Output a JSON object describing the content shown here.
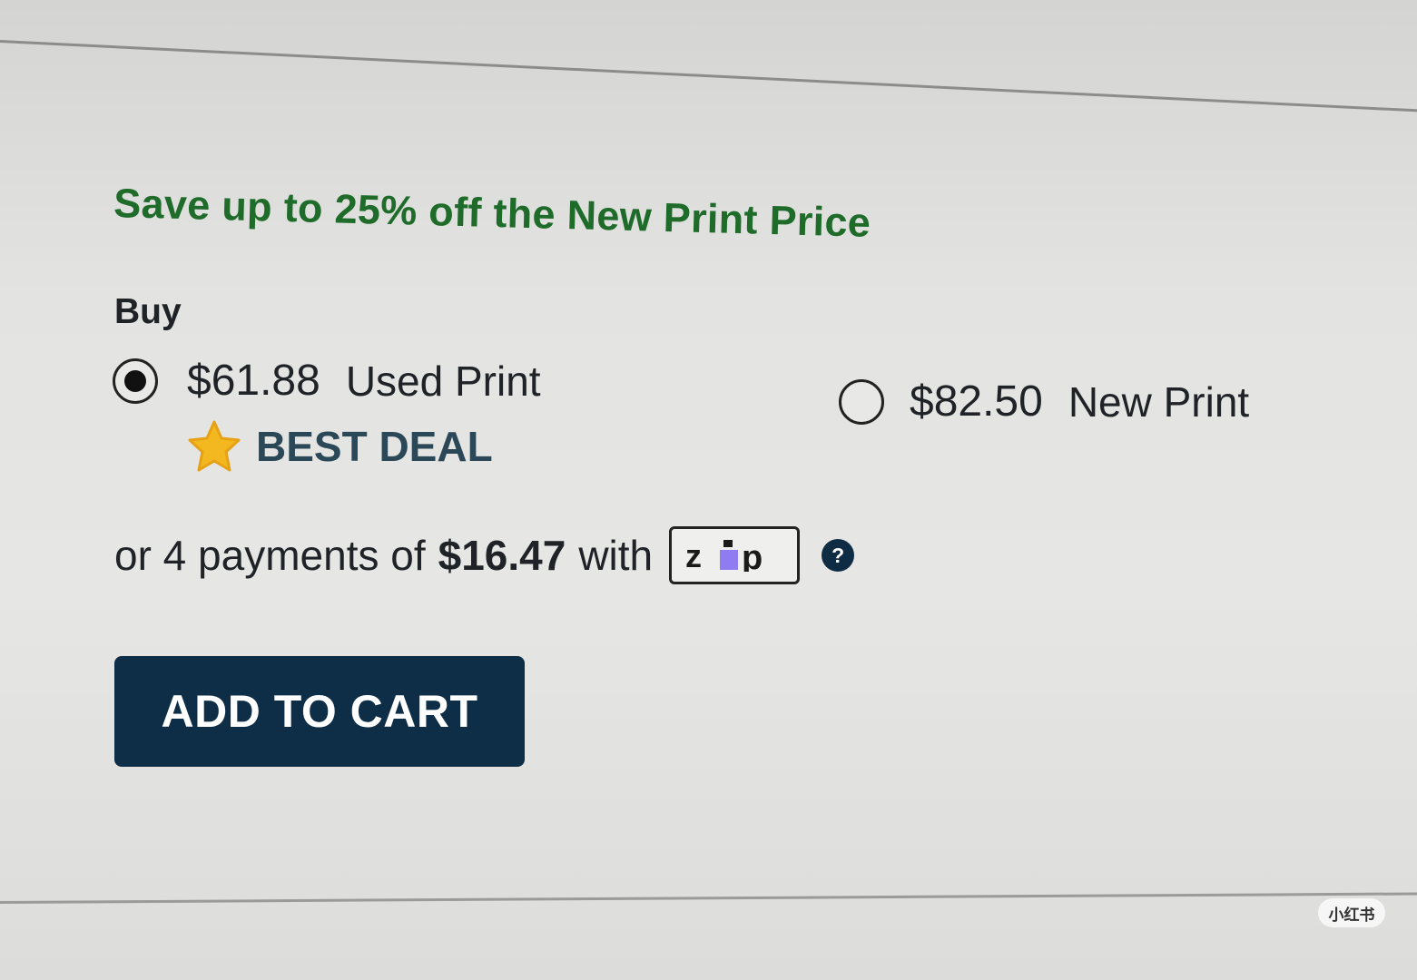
{
  "promo": {
    "text": "Save up to 25% off the New Print Price",
    "color": "#1e6b2a"
  },
  "buy": {
    "label": "Buy",
    "options": [
      {
        "price": "$61.88",
        "name": "Used Print",
        "selected": true,
        "badge": "BEST DEAL",
        "badge_icon": "star-icon"
      },
      {
        "price": "$82.50",
        "name": "New Print",
        "selected": false
      }
    ]
  },
  "payments": {
    "prefix": "or 4 payments of",
    "amount": "$16.47",
    "suffix": "with",
    "provider": "zip",
    "help_icon": "?"
  },
  "cart": {
    "button_label": "ADD TO CART",
    "button_color": "#0e2d46"
  },
  "watermark": {
    "text": "小红书"
  }
}
